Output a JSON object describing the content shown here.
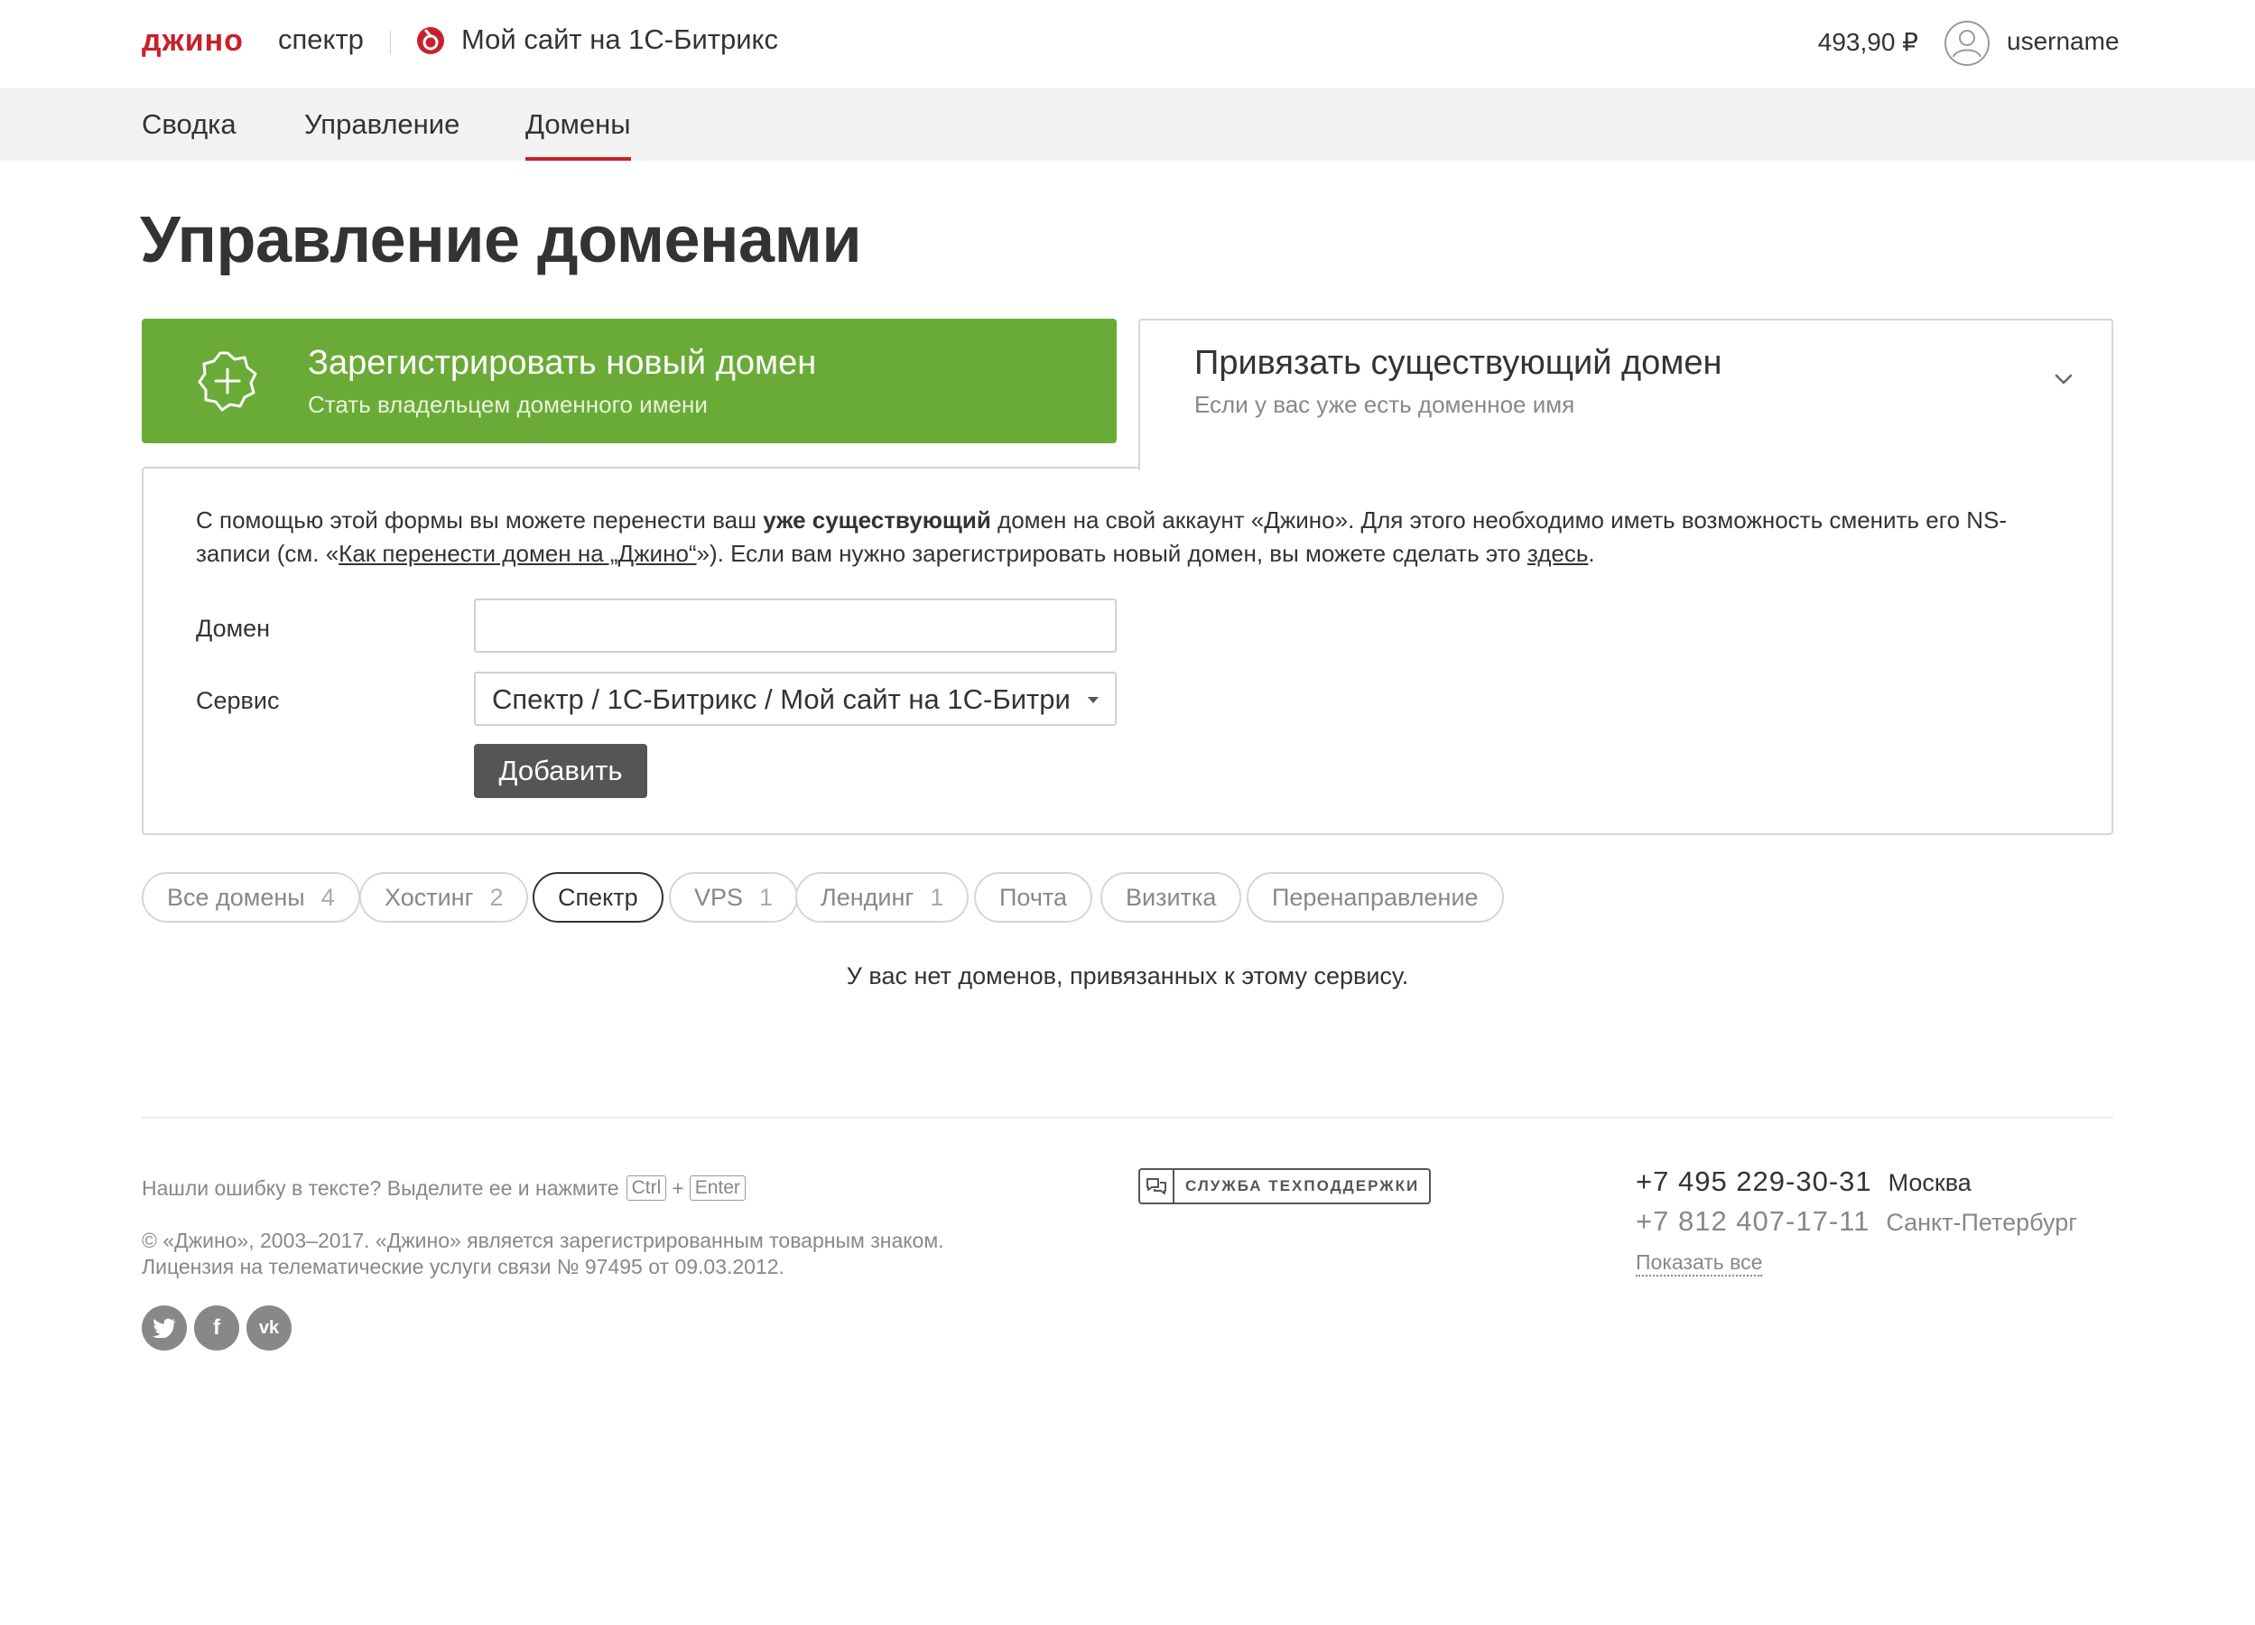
{
  "header": {
    "logo": "джино",
    "logo_sub": "спектр",
    "site_name": "Мой сайт на 1С-Битрикс",
    "balance": "493,90 ₽",
    "username": "username"
  },
  "nav": {
    "items": [
      {
        "label": "Сводка",
        "active": false
      },
      {
        "label": "Управление",
        "active": false
      },
      {
        "label": "Домены",
        "active": true
      }
    ]
  },
  "page": {
    "title": "Управление доменами"
  },
  "register_card": {
    "title": "Зарегистрировать новый домен",
    "subtitle": "Стать владельцем доменного имени"
  },
  "attach_card": {
    "title": "Привязать существующий домен",
    "subtitle": "Если у вас уже есть доменное имя"
  },
  "form": {
    "text_1": "С помощью этой формы вы можете перенести ваш ",
    "text_bold": "уже существующий",
    "text_2": " домен на свой аккаунт «Джино». Для этого необходимо иметь возможность сменить его NS-записи (см. «",
    "link_transfer": "Как перенести домен на „Джино“",
    "text_3": "»). Если вам нужно зарегистрировать новый домен, вы можете сделать это ",
    "link_here": "здесь",
    "text_4": ".",
    "domain_label": "Домен",
    "domain_value": "",
    "service_label": "Сервис",
    "service_value": "Спектр / 1С-Битрикс / Мой сайт на 1С-Битрикс",
    "add_button": "Добавить"
  },
  "filters": [
    {
      "label": "Все домены",
      "count": "4"
    },
    {
      "label": "Хостинг",
      "count": "2"
    },
    {
      "label": "Спектр",
      "count": "",
      "active": true
    },
    {
      "label": "VPS",
      "count": "1"
    },
    {
      "label": "Лендинг",
      "count": "1"
    },
    {
      "label": "Почта",
      "count": ""
    },
    {
      "label": "Визитка",
      "count": ""
    },
    {
      "label": "Перенаправление",
      "count": ""
    }
  ],
  "empty_message": "У вас нет доменов, привязанных к этому сервису.",
  "footer": {
    "error_text": "Нашли ошибку в тексте? Выделите ее и нажмите",
    "key_ctrl": "Ctrl",
    "key_plus": "+",
    "key_enter": "Enter",
    "copyright_1": "© «Джино», 2003–2017. «Джино» является зарегистрированным товарным знаком.",
    "copyright_2": "Лицензия на телематические услуги связи № 97495 от 09.03.2012.",
    "support_label": "СЛУЖБА ТЕХПОДДЕРЖКИ",
    "phones": [
      {
        "number": "+7 495 229-30-31",
        "city": "Москва",
        "color": "#333333"
      },
      {
        "number": "+7 812 407-17-11",
        "city": "Санкт-Петербург",
        "color": "#888888"
      }
    ],
    "show_all": "Показать все",
    "social": [
      {
        "icon": "twitter-icon"
      },
      {
        "icon": "facebook-icon",
        "glyph": "f"
      },
      {
        "icon": "vk-icon",
        "glyph": "vk"
      }
    ]
  },
  "colors": {
    "brand_red": "#c8202a",
    "green": "#6aab37",
    "button_dark": "#555555"
  }
}
